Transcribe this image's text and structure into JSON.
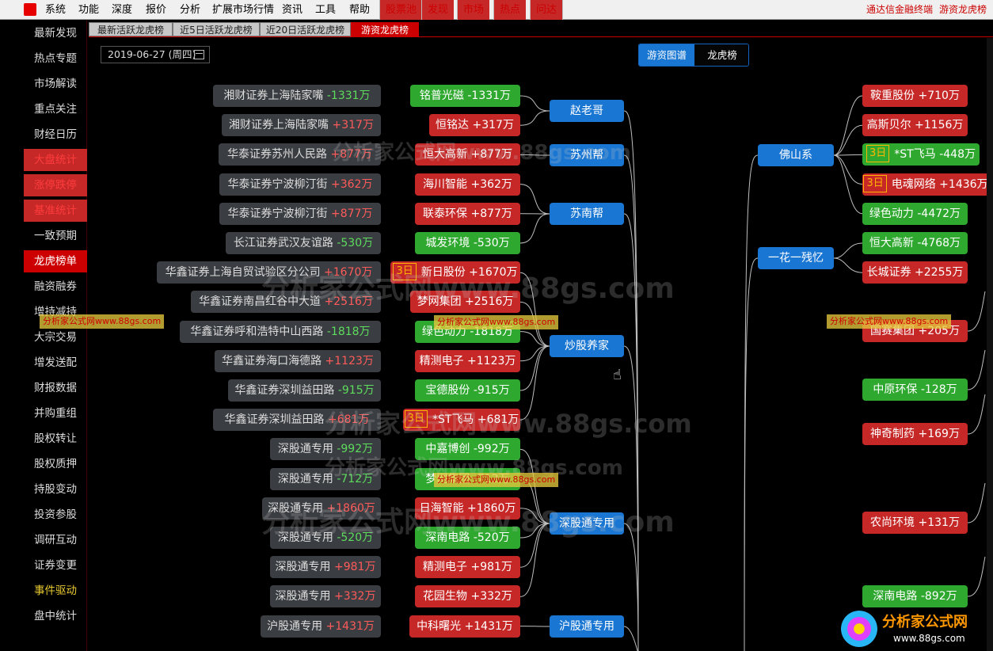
{
  "menubar": {
    "items": [
      "系统",
      "功能",
      "深度",
      "报价",
      "分析",
      "扩展市场行情",
      "资讯",
      "工具",
      "帮助"
    ],
    "red_items": [
      "股票池",
      "发现",
      "市场",
      "热点",
      "问达"
    ],
    "right": [
      "通达信金融终端",
      "游资龙虎榜"
    ]
  },
  "sidebar": {
    "items": [
      "最新发现",
      "热点专题",
      "市场解读",
      "重点关注",
      "财经日历",
      "大盘统计",
      "涨停跌停",
      "基准统计",
      "一致预期",
      "龙虎榜单",
      "融资融券",
      "增持减持",
      "大宗交易",
      "增发送配",
      "财报数据",
      "并购重组",
      "股权转让",
      "股权质押",
      "持股变动",
      "投资参股",
      "调研互动",
      "证券变更",
      "事件驱动",
      "盘中统计"
    ],
    "active": "龙虎榜单"
  },
  "tabs": [
    "最新活跃龙虎榜",
    "近5日活跃龙虎榜",
    "近20日活跃龙虎榜",
    "游资龙虎榜"
  ],
  "date": "2019-06-27 (周四)",
  "view_toggle": {
    "active": "游资图谱",
    "inactive": "龙虎榜"
  },
  "colors": {
    "up": "#ff5b5b",
    "down": "#5ddc5d",
    "group": "#1976d2",
    "stock_up": "#c62828",
    "stock_down": "#2fa82f"
  },
  "left_groups": [
    {
      "name": "赵老哥",
      "rows": [
        {
          "seat": "湘财证券上海陆家嘴",
          "amount": "-1331万",
          "stock": "铭普光磁",
          "stock_amount": "-1331万",
          "tag": ""
        },
        {
          "seat": "湘财证券上海陆家嘴",
          "amount": "+317万",
          "stock": "恒铭达",
          "stock_amount": "+317万",
          "tag": ""
        }
      ]
    },
    {
      "name": "苏州帮",
      "rows": [
        {
          "seat": "华泰证券苏州人民路",
          "amount": "+877万",
          "stock": "恒大高新",
          "stock_amount": "+877万",
          "tag": ""
        }
      ]
    },
    {
      "name": "苏南帮",
      "rows": [
        {
          "seat": "华泰证券宁波柳汀街",
          "amount": "+362万",
          "stock": "海川智能",
          "stock_amount": "+362万",
          "tag": ""
        },
        {
          "seat": "华泰证券宁波柳汀街",
          "amount": "+877万",
          "stock": "联泰环保",
          "stock_amount": "+877万",
          "tag": ""
        },
        {
          "seat": "长江证券武汉友谊路",
          "amount": "-530万",
          "stock": "城发环境",
          "stock_amount": "-530万",
          "tag": ""
        }
      ]
    },
    {
      "name": "炒股养家",
      "rows": [
        {
          "seat": "华鑫证券上海自贸试验区分公司",
          "amount": "+1670万",
          "stock": "新日股份",
          "stock_amount": "+1670万",
          "tag": "3日"
        },
        {
          "seat": "华鑫证券南昌红谷中大道",
          "amount": "+2516万",
          "stock": "梦网集团",
          "stock_amount": "+2516万",
          "tag": ""
        },
        {
          "seat": "华鑫证券呼和浩特中山西路",
          "amount": "-1818万",
          "stock": "绿色动力",
          "stock_amount": "-1818万",
          "tag": ""
        },
        {
          "seat": "华鑫证券海口海德路",
          "amount": "+1123万",
          "stock": "精测电子",
          "stock_amount": "+1123万",
          "tag": ""
        },
        {
          "seat": "华鑫证券深圳益田路",
          "amount": "-915万",
          "stock": "宝德股份",
          "stock_amount": "-915万",
          "tag": ""
        },
        {
          "seat": "华鑫证券深圳益田路",
          "amount": "+681万",
          "stock": "*ST飞马",
          "stock_amount": "+681万",
          "tag": "3日"
        }
      ]
    },
    {
      "name": "深股通专用",
      "rows": [
        {
          "seat": "深股通专用",
          "amount": "-992万",
          "stock": "中嘉博创",
          "stock_amount": "-992万",
          "tag": ""
        },
        {
          "seat": "深股通专用",
          "amount": "-712万",
          "stock": "梦网集团",
          "stock_amount": "-712万",
          "tag": ""
        },
        {
          "seat": "深股通专用",
          "amount": "+1860万",
          "stock": "日海智能",
          "stock_amount": "+1860万",
          "tag": ""
        },
        {
          "seat": "深股通专用",
          "amount": "-520万",
          "stock": "深南电路",
          "stock_amount": "-520万",
          "tag": ""
        },
        {
          "seat": "深股通专用",
          "amount": "+981万",
          "stock": "精测电子",
          "stock_amount": "+981万",
          "tag": ""
        },
        {
          "seat": "深股通专用",
          "amount": "+332万",
          "stock": "花园生物",
          "stock_amount": "+332万",
          "tag": ""
        }
      ]
    },
    {
      "name": "沪股通专用",
      "rows": [
        {
          "seat": "沪股通专用",
          "amount": "+1431万",
          "stock": "中科曙光",
          "stock_amount": "+1431万",
          "tag": ""
        }
      ]
    }
  ],
  "right_groups": [
    {
      "name": "佛山系",
      "stocks": [
        {
          "stock": "鞍重股份",
          "amount": "+710万",
          "tag": ""
        },
        {
          "stock": "高斯贝尔",
          "amount": "+1156万",
          "tag": ""
        },
        {
          "stock": "*ST飞马",
          "amount": "-448万",
          "tag": "3日"
        },
        {
          "stock": "电魂网络",
          "amount": "+1436万",
          "tag": "3日"
        },
        {
          "stock": "绿色动力",
          "amount": "-4472万",
          "tag": ""
        }
      ]
    },
    {
      "name": "一花一残忆",
      "stocks": [
        {
          "stock": "恒大高新",
          "amount": "-4768万",
          "tag": ""
        },
        {
          "stock": "长城证券",
          "amount": "+2255万",
          "tag": ""
        }
      ]
    }
  ],
  "right_stocks": [
    {
      "stock": "国赛集团",
      "amount": "+205万"
    },
    {
      "stock": "中原环保",
      "amount": "-128万"
    },
    {
      "stock": "神奇制药",
      "amount": "+169万"
    },
    {
      "stock": "农尚环境",
      "amount": "+131万"
    },
    {
      "stock": "深南电路",
      "amount": "-892万"
    }
  ],
  "watermarks": {
    "big": "分析家公式网www.88gs.com",
    "small": "分析家公式网www.88gs.com"
  },
  "brand": {
    "name": "分析家公式网",
    "url": "www.88gs.com"
  }
}
